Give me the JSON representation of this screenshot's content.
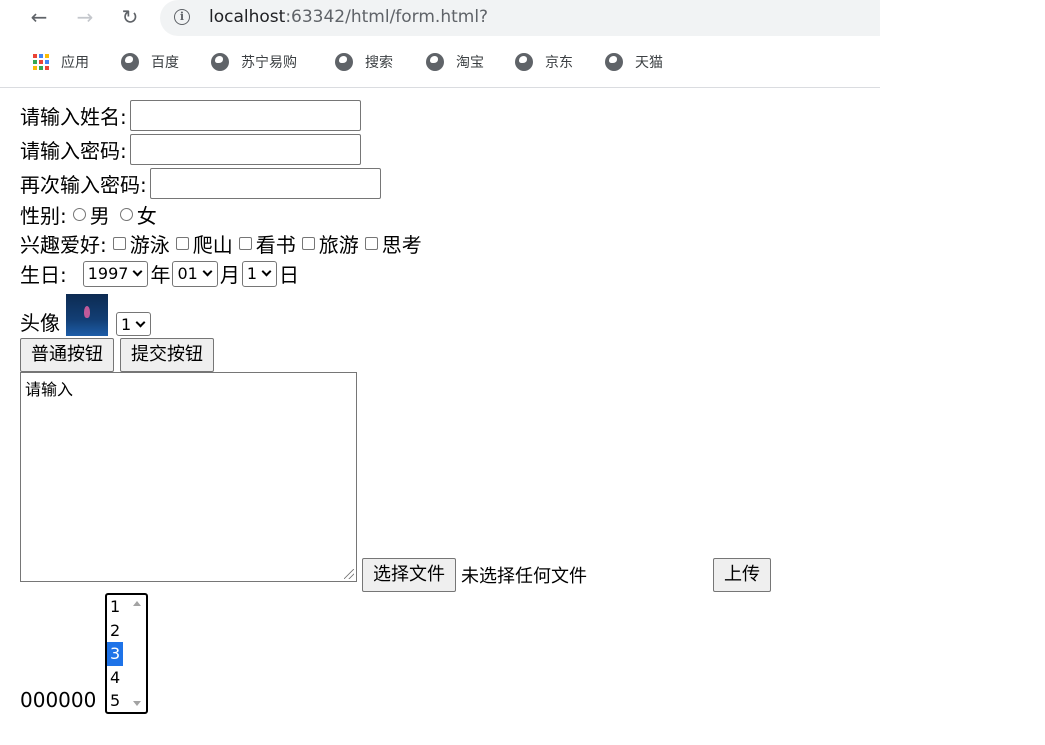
{
  "browser": {
    "url_host": "localhost",
    "url_rest": ":63342/html/form.html?",
    "bookmarks": [
      {
        "label": "应用",
        "icon": "apps-grid-icon"
      },
      {
        "label": "百度",
        "icon": "globe-icon"
      },
      {
        "label": "苏宁易购",
        "icon": "globe-icon"
      },
      {
        "label": "搜索",
        "icon": "globe-icon"
      },
      {
        "label": "淘宝",
        "icon": "globe-icon"
      },
      {
        "label": "京东",
        "icon": "globe-icon"
      },
      {
        "label": "天猫",
        "icon": "globe-icon"
      }
    ]
  },
  "form": {
    "name_label": "请输入姓名:",
    "password_label": "请输入密码:",
    "confirm_label": "再次输入密码:",
    "gender_label": "性别:",
    "gender_options": [
      "男",
      "女"
    ],
    "hobby_label": "兴趣爱好:",
    "hobbies": [
      "游泳",
      "爬山",
      "看书",
      "旅游",
      "思考"
    ],
    "birthday_label": "生日:",
    "year_value": "1997",
    "year_unit": "年",
    "month_value": "01",
    "month_unit": "月",
    "day_value": "1",
    "day_unit": "日",
    "avatar_label": "头像",
    "avatar_select_value": "1",
    "normal_button": "普通按钮",
    "submit_button": "提交按钮",
    "textarea_value": "请输入",
    "file_button": "选择文件",
    "file_status": "未选择任何文件",
    "upload_button": "上传",
    "bottom_text": "000000",
    "list_options": [
      "1",
      "2",
      "3",
      "4",
      "5"
    ],
    "list_selected": "3"
  }
}
